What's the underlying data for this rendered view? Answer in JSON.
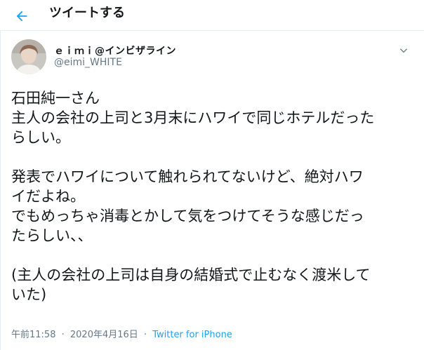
{
  "header": {
    "title": "ツイートする"
  },
  "tweet": {
    "display_name": "ｅｉｍｉ@インビザライン",
    "handle": "@eimi_WHITE",
    "lines": [
      "石田純一さん",
      "主人の会社の上司と3月末にハワイで同じホテルだった",
      "らしい。",
      "",
      "発表でハワイについて触れられてないけど、絶対ハワ",
      "イだよね。",
      "でもめっちゃ消毒とかして気をつけてそうな感じだっ",
      "たらしい、、",
      "",
      "(主人の会社の上司は自身の結婚式で止むなく渡米して",
      "いた)"
    ],
    "time": "午前11:58",
    "separator": "·",
    "date": "2020年4月16日",
    "source": "Twitter for iPhone"
  },
  "colors": {
    "accent": "#1da1f2",
    "text": "#14171a",
    "muted": "#657786",
    "border": "#e6ecf0"
  },
  "icons": {
    "back": "arrow-left-icon",
    "more": "chevron-down-icon"
  }
}
